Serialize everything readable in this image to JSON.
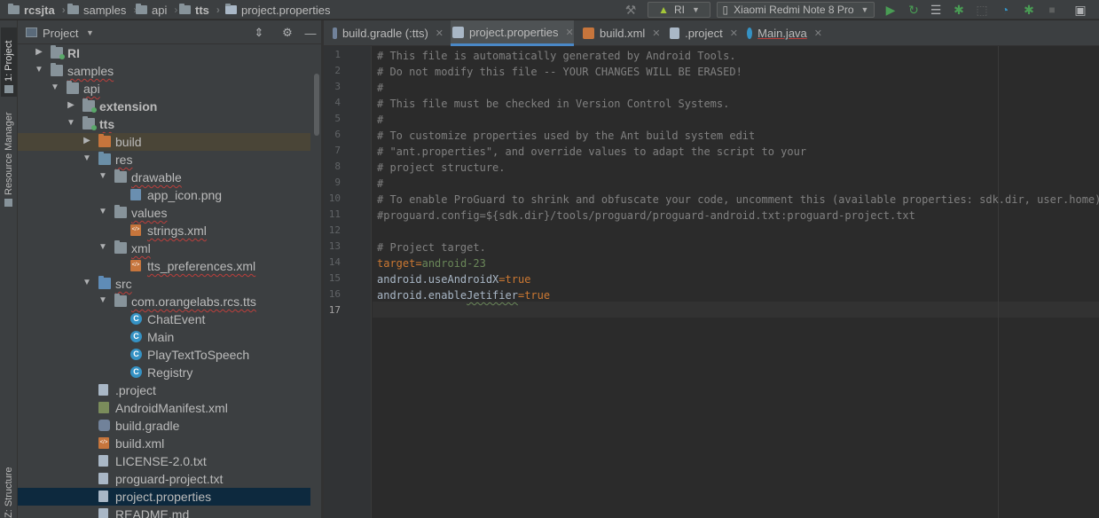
{
  "navbar": {
    "breadcrumbs": [
      "rcsjta",
      "samples",
      "api",
      "tts",
      "project.properties"
    ],
    "run_config": "RI",
    "device": "Xiaomi Redmi Note 8 Pro"
  },
  "tool_stripe": {
    "project_tab": "1: Project",
    "resource_manager_tab": "Resource Manager",
    "structure_tab": "Z: Structure"
  },
  "project_panel": {
    "title": "Project",
    "tree": [
      {
        "label": "RI",
        "depth": 1,
        "arrow": "collapsed",
        "icon": "module-folder-icon",
        "bold": true
      },
      {
        "label": "samples",
        "depth": 1,
        "arrow": "expanded",
        "icon": "folder-icon"
      },
      {
        "label": "api",
        "depth": 2,
        "arrow": "expanded",
        "icon": "folder-icon"
      },
      {
        "label": "extension",
        "depth": 3,
        "arrow": "collapsed",
        "icon": "module-folder-icon",
        "bold": true
      },
      {
        "label": "tts",
        "depth": 3,
        "arrow": "expanded",
        "icon": "module-folder-icon",
        "bold": true
      },
      {
        "label": "build",
        "depth": 4,
        "arrow": "collapsed",
        "icon": "excluded-folder-icon"
      },
      {
        "label": "res",
        "depth": 4,
        "arrow": "expanded",
        "icon": "resource-folder-icon"
      },
      {
        "label": "drawable",
        "depth": 5,
        "arrow": "expanded",
        "icon": "folder-icon"
      },
      {
        "label": "app_icon.png",
        "depth": 6,
        "arrow": "none",
        "icon": "image-file-icon"
      },
      {
        "label": "values",
        "depth": 5,
        "arrow": "expanded",
        "icon": "folder-icon"
      },
      {
        "label": "strings.xml",
        "depth": 6,
        "arrow": "none",
        "icon": "xml-file-icon"
      },
      {
        "label": "xml",
        "depth": 5,
        "arrow": "expanded",
        "icon": "folder-icon"
      },
      {
        "label": "tts_preferences.xml",
        "depth": 6,
        "arrow": "none",
        "icon": "xml-file-icon"
      },
      {
        "label": "src",
        "depth": 4,
        "arrow": "expanded",
        "icon": "source-folder-icon"
      },
      {
        "label": "com.orangelabs.rcs.tts",
        "depth": 5,
        "arrow": "expanded",
        "icon": "package-icon"
      },
      {
        "label": "ChatEvent",
        "depth": 6,
        "arrow": "none",
        "icon": "java-class-icon"
      },
      {
        "label": "Main",
        "depth": 6,
        "arrow": "none",
        "icon": "java-class-icon"
      },
      {
        "label": "PlayTextToSpeech",
        "depth": 6,
        "arrow": "none",
        "icon": "java-class-icon"
      },
      {
        "label": "Registry",
        "depth": 6,
        "arrow": "none",
        "icon": "java-class-icon"
      },
      {
        "label": ".project",
        "depth": 4,
        "arrow": "none",
        "icon": "text-file-icon"
      },
      {
        "label": "AndroidManifest.xml",
        "depth": 4,
        "arrow": "none",
        "icon": "manifest-file-icon"
      },
      {
        "label": "build.gradle",
        "depth": 4,
        "arrow": "none",
        "icon": "gradle-file-icon"
      },
      {
        "label": "build.xml",
        "depth": 4,
        "arrow": "none",
        "icon": "xml-file-icon"
      },
      {
        "label": "LICENSE-2.0.txt",
        "depth": 4,
        "arrow": "none",
        "icon": "text-file-icon"
      },
      {
        "label": "proguard-project.txt",
        "depth": 4,
        "arrow": "none",
        "icon": "text-file-icon"
      },
      {
        "label": "project.properties",
        "depth": 4,
        "arrow": "none",
        "icon": "properties-file-icon"
      },
      {
        "label": "README.md",
        "depth": 4,
        "arrow": "none",
        "icon": "text-file-icon"
      }
    ]
  },
  "editor_tabs": [
    {
      "label": "build.gradle (:tts)",
      "icon": "gradle-file-icon"
    },
    {
      "label": "project.properties",
      "icon": "properties-file-icon",
      "active": true
    },
    {
      "label": "build.xml",
      "icon": "xml-file-icon"
    },
    {
      "label": ".project",
      "icon": "text-file-icon"
    },
    {
      "label": "Main.java",
      "icon": "java-class-icon"
    }
  ],
  "editor": {
    "current_line": 17,
    "lines": [
      "# This file is automatically generated by Android Tools.",
      "# Do not modify this file -- YOUR CHANGES WILL BE ERASED!",
      "#",
      "# This file must be checked in Version Control Systems.",
      "#",
      "# To customize properties used by the Ant build system edit",
      "# \"ant.properties\", and override values to adapt the script to your",
      "# project structure.",
      "#",
      "# To enable ProGuard to shrink and obfuscate your code, uncomment this (available properties: sdk.dir, user.home):",
      "#proguard.config=${sdk.dir}/tools/proguard/proguard-android.txt:proguard-project.txt",
      "",
      "# Project target.",
      "target=android-23",
      "android.useAndroidX=true",
      "android.enableJetifier=true",
      ""
    ]
  },
  "colors": {
    "accent": "#4a88c7",
    "comment": "#808080",
    "keyword": "#cc7832",
    "value": "#6a8759"
  }
}
